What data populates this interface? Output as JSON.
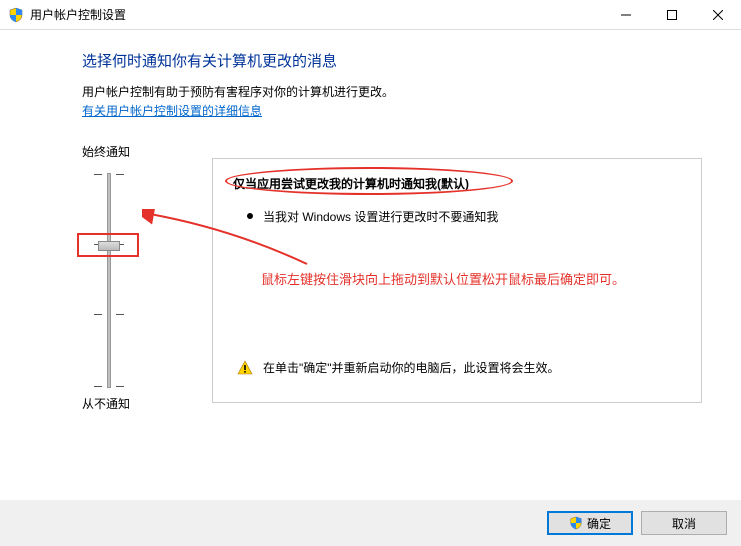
{
  "titlebar": {
    "title": "用户帐户控制设置"
  },
  "heading": "选择何时通知你有关计算机更改的消息",
  "description": "用户帐户控制有助于预防有害程序对你的计算机进行更改。",
  "help_link": "有关用户帐户控制设置的详细信息",
  "slider": {
    "top_label": "始终通知",
    "bottom_label": "从不通知"
  },
  "info": {
    "title": "仅当应用尝试更改我的计算机时通知我(默认)",
    "bullet1": "当我对 Windows 设置进行更改时不要通知我",
    "warning": "在单击\"确定\"并重新启动你的电脑后，此设置将会生效。"
  },
  "annotation": "鼠标左键按住滑块向上拖动到默认位置松开鼠标最后确定即可。",
  "buttons": {
    "ok": "确定",
    "cancel": "取消"
  }
}
